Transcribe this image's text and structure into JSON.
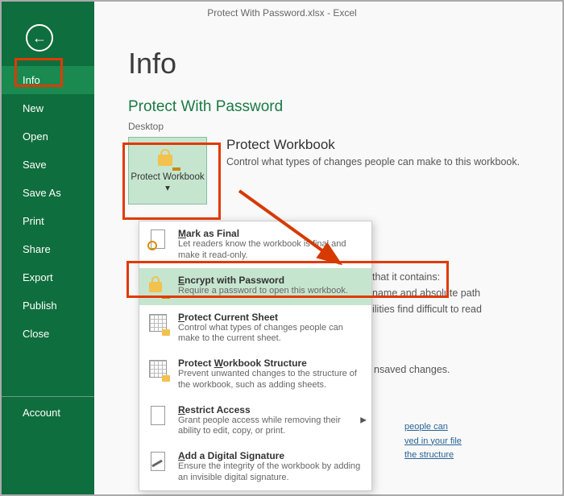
{
  "titlebar": "Protect With Password.xlsx - Excel",
  "sidebar": {
    "items": [
      {
        "label": "Info",
        "active": true
      },
      {
        "label": "New"
      },
      {
        "label": "Open"
      },
      {
        "label": "Save"
      },
      {
        "label": "Save As"
      },
      {
        "label": "Print"
      },
      {
        "label": "Share"
      },
      {
        "label": "Export"
      },
      {
        "label": "Publish"
      },
      {
        "label": "Close"
      }
    ],
    "account": "Account"
  },
  "main": {
    "page_title": "Info",
    "doc_title": "Protect With Password",
    "doc_location": "Desktop",
    "protect_btn": "Protect Workbook",
    "protect_btn_caret": "▾",
    "protect_head": "Protect Workbook",
    "protect_sub": "Control what types of changes people can make to this workbook.",
    "right_frag": {
      "l1": "that it contains:",
      "l2": "name and absolute path",
      "l3": "ilities find difficult to read"
    },
    "unsaved_frag": "nsaved changes.",
    "link_people": "people can",
    "link_structure": "the structure",
    "link_file": "ved in your file"
  },
  "dropdown": [
    {
      "title_pre": "",
      "title_u": "M",
      "title_post": "ark as Final",
      "desc": "Let readers know the workbook is final and make it read-only.",
      "icon": "mark-final"
    },
    {
      "title_pre": "",
      "title_u": "E",
      "title_post": "ncrypt with Password",
      "desc": "Require a password to open this workbook.",
      "icon": "encrypt",
      "selected": true
    },
    {
      "title_pre": "",
      "title_u": "P",
      "title_post": "rotect Current Sheet",
      "desc": "Control what types of changes people can make to the current sheet.",
      "icon": "sheet"
    },
    {
      "title_pre": "Protect ",
      "title_u": "W",
      "title_post": "orkbook Structure",
      "desc": "Prevent unwanted changes to the structure of the workbook, such as adding sheets.",
      "icon": "structure"
    },
    {
      "title_pre": "",
      "title_u": "R",
      "title_post": "estrict Access",
      "desc": "Grant people access while removing their ability to edit, copy, or print.",
      "icon": "restrict",
      "chevron": "▶"
    },
    {
      "title_pre": "",
      "title_u": "A",
      "title_post": "dd a Digital Signature",
      "desc": "Ensure the integrity of the workbook by adding an invisible digital signature.",
      "icon": "sign"
    }
  ]
}
